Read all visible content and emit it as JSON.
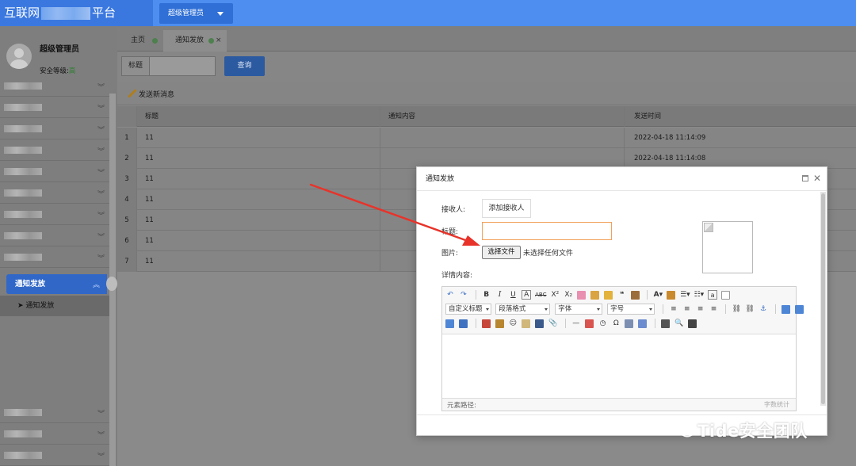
{
  "header": {
    "brand_prefix": "互联网",
    "brand_suffix": "平台",
    "role_button": "超级管理员"
  },
  "sidebar": {
    "user_name": "超级管理员",
    "security_label": "安全等级:",
    "security_value": "高",
    "active_menu": "通知发放",
    "submenu_item": "通知发放"
  },
  "tabs": [
    {
      "label": "主页"
    },
    {
      "label": "通知发放"
    }
  ],
  "search": {
    "label": "标题",
    "button": "查询"
  },
  "toolbar": {
    "send_new": "发送新消息"
  },
  "table": {
    "columns": [
      "标题",
      "通知内容",
      "发送时间"
    ],
    "rows": [
      {
        "idx": "1",
        "title": "11",
        "content": "",
        "time": "2022-04-18 11:14:09"
      },
      {
        "idx": "2",
        "title": "11",
        "content": "",
        "time": "2022-04-18 11:14:08"
      },
      {
        "idx": "3",
        "title": "11",
        "content": "",
        "time": ""
      },
      {
        "idx": "4",
        "title": "11",
        "content": "",
        "time": ""
      },
      {
        "idx": "5",
        "title": "11",
        "content": "",
        "time": ""
      },
      {
        "idx": "6",
        "title": "11",
        "content": "",
        "time": ""
      },
      {
        "idx": "7",
        "title": "11",
        "content": "",
        "time": ""
      }
    ]
  },
  "modal": {
    "title": "通知发放",
    "recipient_label": "接收人:",
    "add_recipient": "添加接收人",
    "title_label": "标题:",
    "image_label": "图片:",
    "choose_file": "选择文件",
    "no_file": "未选择任何文件",
    "detail_label": "详情内容:",
    "editor": {
      "sel_custom_title": "自定义标题",
      "sel_paragraph": "段落格式",
      "sel_font": "字体",
      "sel_size": "字号",
      "element_path": "元素路径:",
      "word_count": "字数统计"
    }
  },
  "watermark": {
    "text": "Tide安全团队"
  },
  "colors": {
    "topbar": "#4d8ef0",
    "brand_bg": "#3a78e0",
    "primary_button": "#2f6fd6",
    "active_menu": "#3168c8",
    "arrow": "#e8332a",
    "title_input_border": "#f2a05a"
  }
}
